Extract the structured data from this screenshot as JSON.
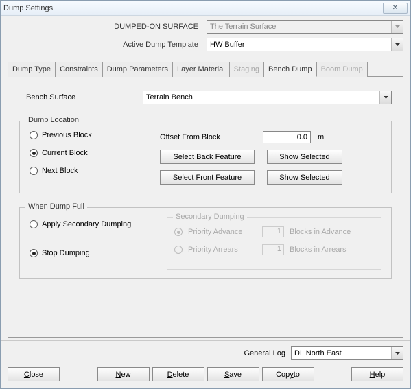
{
  "window": {
    "title": "Dump Settings",
    "close_x": "✕"
  },
  "header": {
    "dumped_label": "DUMPED-ON SURFACE",
    "dumped_value": "The Terrain Surface",
    "template_label": "Active Dump Template",
    "template_value": "HW Buffer"
  },
  "tabs": {
    "dump_type": "Dump Type",
    "constraints": "Constraints",
    "dump_params": "Dump Parameters",
    "layer_material": "Layer Material",
    "staging": "Staging",
    "bench_dump": "Bench Dump",
    "boom_dump": "Boom Dump"
  },
  "bench_surface": {
    "label": "Bench Surface",
    "value": "Terrain Bench"
  },
  "dump_location": {
    "legend": "Dump Location",
    "previous": "Previous Block",
    "current": "Current Block",
    "next": "Next Block",
    "offset_label": "Offset From Block",
    "offset_value": "0.0",
    "offset_unit": "m",
    "select_back": "Select Back Feature",
    "select_front": "Select Front Feature",
    "show_selected": "Show Selected"
  },
  "when_full": {
    "legend": "When Dump Full",
    "apply": "Apply Secondary Dumping",
    "stop": "Stop Dumping",
    "inner_legend": "Secondary Dumping",
    "priority_advance": "Priority Advance",
    "priority_arrears": "Priority Arrears",
    "advance_val": "1",
    "arrears_val": "1",
    "advance_suffix": "Blocks in Advance",
    "arrears_suffix": "Blocks in Arrears"
  },
  "general_log": {
    "label": "General Log",
    "value": "DL North East"
  },
  "buttons": {
    "close": "Close",
    "new": "New",
    "delete": "Delete",
    "save": "Save",
    "copy_to": "Copy to",
    "help": "Help"
  }
}
